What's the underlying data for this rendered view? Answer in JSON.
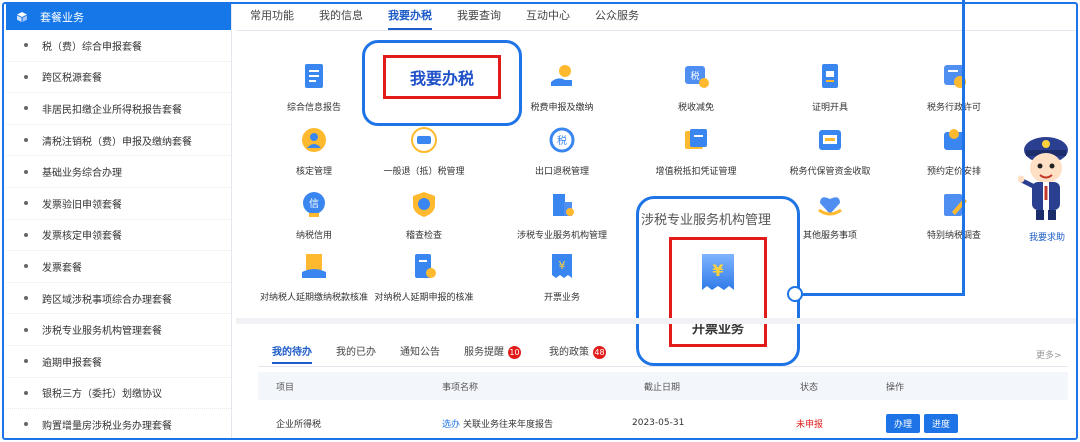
{
  "sidebar": {
    "title": "套餐业务",
    "items": [
      {
        "label": "税（费）综合申报套餐"
      },
      {
        "label": "跨区税源套餐"
      },
      {
        "label": "非居民扣缴企业所得税报告套餐"
      },
      {
        "label": "清税注销税（费）申报及缴纳套餐"
      },
      {
        "label": "基础业务综合办理"
      },
      {
        "label": "发票验旧申领套餐"
      },
      {
        "label": "发票核定申领套餐"
      },
      {
        "label": "发票套餐"
      },
      {
        "label": "跨区域涉税事项综合办理套餐"
      },
      {
        "label": "涉税专业服务机构管理套餐"
      },
      {
        "label": "逾期申报套餐"
      },
      {
        "label": "银税三方（委托）划缴协议"
      },
      {
        "label": "购置增量房涉税业务办理套餐"
      }
    ]
  },
  "topnav": {
    "tabs": [
      {
        "label": "常用功能"
      },
      {
        "label": "我的信息"
      },
      {
        "label": "我要办税",
        "active": true
      },
      {
        "label": "我要查询"
      },
      {
        "label": "互动中心"
      },
      {
        "label": "公众服务"
      }
    ]
  },
  "services": {
    "row1": [
      {
        "label": "综合信息报告",
        "icon": "report-icon"
      },
      {
        "label": "",
        "icon": "blank"
      },
      {
        "label": "税费申报及缴纳",
        "icon": "coin-hand-icon"
      },
      {
        "label": "税收减免",
        "icon": "tax-reduce-icon"
      },
      {
        "label": "证明开具",
        "icon": "certificate-icon"
      },
      {
        "label": "税务行政许可",
        "icon": "permit-icon"
      }
    ],
    "row2": [
      {
        "label": "核定管理",
        "icon": "person-check-icon"
      },
      {
        "label": "一般退（抵）税管理",
        "icon": "refund-icon"
      },
      {
        "label": "出口退税管理",
        "icon": "export-refund-icon"
      },
      {
        "label": "增值税抵扣凭证管理",
        "icon": "voucher-icon"
      },
      {
        "label": "税务代保管资金收取",
        "icon": "fund-icon"
      },
      {
        "label": "预约定价安排",
        "icon": "pricing-icon"
      }
    ],
    "row3": [
      {
        "label": "纳税信用",
        "icon": "credit-icon"
      },
      {
        "label": "稽查检查",
        "icon": "inspect-icon"
      },
      {
        "label": "涉税专业服务机构管理",
        "icon": "agency-icon"
      },
      {
        "label": "",
        "icon": "blank"
      },
      {
        "label": "其他服务事项",
        "icon": "heart-hand-icon"
      },
      {
        "label": "特别纳税调查",
        "icon": "special-survey-icon"
      }
    ],
    "row4": [
      {
        "label": "对纳税人延期缴纳税款核准",
        "icon": "delay-pay-icon"
      },
      {
        "label": "对纳税人延期申报的核准",
        "icon": "delay-report-icon"
      },
      {
        "label": "开票业务",
        "icon": "invoice-icon"
      }
    ]
  },
  "callouts": {
    "tax_title": "我要办税",
    "invoice_ghost": "涉税专业服务机构管理",
    "invoice_title": "开票业务"
  },
  "help": {
    "label": "我要求助"
  },
  "bottom": {
    "tabs": [
      {
        "label": "我的待办",
        "active": true
      },
      {
        "label": "我的已办"
      },
      {
        "label": "通知公告"
      },
      {
        "label": "服务提醒",
        "badge": "10"
      },
      {
        "label": "我的政策",
        "badge": "48"
      }
    ],
    "more": "更多>",
    "table": {
      "headers": [
        "项目",
        "事项名称",
        "截止日期",
        "状态",
        "操作"
      ],
      "rows": [
        {
          "project": "企业所得税",
          "link": "选办",
          "item": "关联业务往来年度报告",
          "deadline": "2023-05-31",
          "status": "未申报",
          "actions": [
            "办理",
            "进度"
          ]
        }
      ]
    }
  },
  "colors": {
    "primary": "#1e74e6",
    "accent_red": "#e11a1a",
    "sidebar_header": "#1677e9"
  }
}
